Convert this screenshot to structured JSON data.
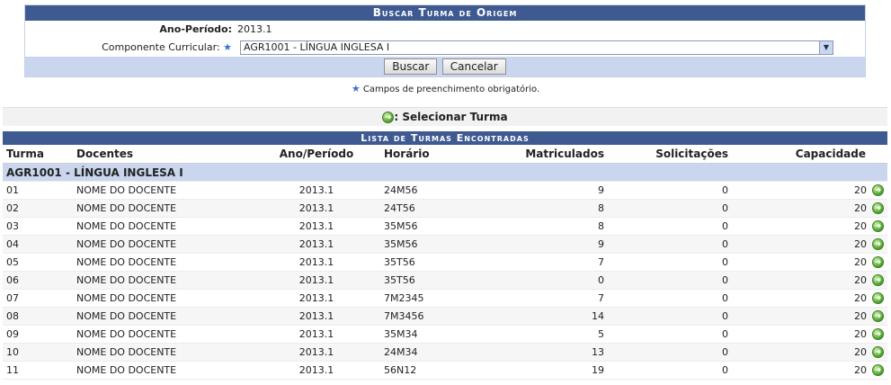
{
  "search_form": {
    "title": "Buscar Turma de Origem",
    "ano_periodo_label": "Ano-Período:",
    "ano_periodo_value": "2013.1",
    "componente_label": "Componente Curricular:",
    "componente_value": "AGR1001 - LÍNGUA INGLESA I",
    "buscar_label": "Buscar",
    "cancelar_label": "Cancelar",
    "required_note": "Campos de preenchimento obrigatório."
  },
  "legend": {
    "text": ": Selecionar Turma",
    "icon": "select-arrow-icon"
  },
  "results": {
    "title": "Lista de Turmas Encontradas",
    "columns": [
      "Turma",
      "Docentes",
      "Ano/Período",
      "Horário",
      "Matriculados",
      "Solicitações",
      "Capacidade"
    ],
    "group": "AGR1001 - LÍNGUA INGLESA I",
    "rows": [
      {
        "turma": "01",
        "docente": "NOME DO DOCENTE",
        "ano": "2013.1",
        "horario": "24M56",
        "matriculados": "9",
        "solicitacoes": "0",
        "capacidade": "20"
      },
      {
        "turma": "02",
        "docente": "NOME DO DOCENTE",
        "ano": "2013.1",
        "horario": "24T56",
        "matriculados": "8",
        "solicitacoes": "0",
        "capacidade": "20"
      },
      {
        "turma": "03",
        "docente": "NOME DO DOCENTE",
        "ano": "2013.1",
        "horario": "35M56",
        "matriculados": "8",
        "solicitacoes": "0",
        "capacidade": "20"
      },
      {
        "turma": "04",
        "docente": "NOME DO DOCENTE",
        "ano": "2013.1",
        "horario": "35M56",
        "matriculados": "9",
        "solicitacoes": "0",
        "capacidade": "20"
      },
      {
        "turma": "05",
        "docente": "NOME DO DOCENTE",
        "ano": "2013.1",
        "horario": "35T56",
        "matriculados": "7",
        "solicitacoes": "0",
        "capacidade": "20"
      },
      {
        "turma": "06",
        "docente": "NOME DO DOCENTE",
        "ano": "2013.1",
        "horario": "35T56",
        "matriculados": "0",
        "solicitacoes": "0",
        "capacidade": "20"
      },
      {
        "turma": "07",
        "docente": "NOME DO DOCENTE",
        "ano": "2013.1",
        "horario": "7M2345",
        "matriculados": "7",
        "solicitacoes": "0",
        "capacidade": "20"
      },
      {
        "turma": "08",
        "docente": "NOME DO DOCENTE",
        "ano": "2013.1",
        "horario": "7M3456",
        "matriculados": "14",
        "solicitacoes": "0",
        "capacidade": "20"
      },
      {
        "turma": "09",
        "docente": "NOME DO DOCENTE",
        "ano": "2013.1",
        "horario": "35M34",
        "matriculados": "5",
        "solicitacoes": "0",
        "capacidade": "20"
      },
      {
        "turma": "10",
        "docente": "NOME DO DOCENTE",
        "ano": "2013.1",
        "horario": "24M34",
        "matriculados": "13",
        "solicitacoes": "0",
        "capacidade": "20"
      },
      {
        "turma": "11",
        "docente": "NOME DO DOCENTE",
        "ano": "2013.1",
        "horario": "56N12",
        "matriculados": "19",
        "solicitacoes": "0",
        "capacidade": "20"
      }
    ]
  },
  "colors": {
    "caption_bg": "#3f5a91",
    "band_bg": "#c9d6ee",
    "go_icon": "#4ea12a",
    "required_star": "#3b6fd1"
  }
}
